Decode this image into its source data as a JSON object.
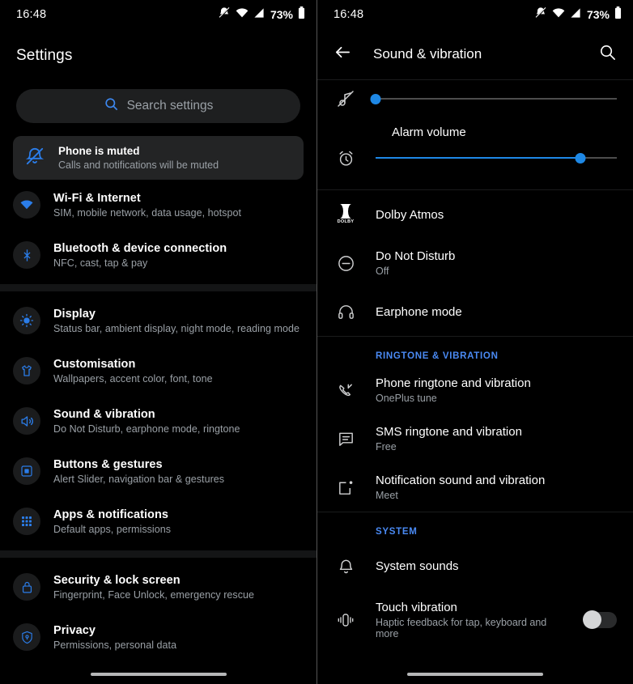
{
  "accent": "#1e88e5",
  "section_header_color": "#4a8af4",
  "status_bar": {
    "time": "16:48",
    "battery_percent": "73%",
    "icons": [
      "bell-slash-icon",
      "wifi-icon",
      "signal-icon",
      "battery-icon"
    ]
  },
  "left_panel": {
    "title": "Settings",
    "search": {
      "placeholder": "Search settings",
      "icon": "search-icon"
    },
    "muted_banner": {
      "icon": "bell-slash-icon",
      "title": "Phone is muted",
      "subtitle": "Calls and notifications will be muted"
    },
    "groups": [
      {
        "items": [
          {
            "icon": "wifi-icon",
            "title": "Wi-Fi & Internet",
            "subtitle": "SIM, mobile network, data usage, hotspot"
          },
          {
            "icon": "bluetooth-icon",
            "title": "Bluetooth & device connection",
            "subtitle": "NFC, cast, tap & pay"
          }
        ]
      },
      {
        "items": [
          {
            "icon": "brightness-icon",
            "title": "Display",
            "subtitle": "Status bar, ambient display, night mode, reading mode"
          },
          {
            "icon": "tshirt-icon",
            "title": "Customisation",
            "subtitle": "Wallpapers, accent color, font, tone"
          },
          {
            "icon": "speaker-icon",
            "title": "Sound & vibration",
            "subtitle": "Do Not Disturb, earphone mode, ringtone"
          },
          {
            "icon": "button-box-icon",
            "title": "Buttons & gestures",
            "subtitle": "Alert Slider, navigation bar & gestures"
          },
          {
            "icon": "app-grid-icon",
            "title": "Apps & notifications",
            "subtitle": "Default apps, permissions"
          }
        ]
      },
      {
        "items": [
          {
            "icon": "lock-icon",
            "title": "Security & lock screen",
            "subtitle": "Fingerprint, Face Unlock, emergency rescue"
          },
          {
            "icon": "shield-icon",
            "title": "Privacy",
            "subtitle": "Permissions, personal data"
          }
        ]
      }
    ]
  },
  "right_panel": {
    "header": {
      "back_icon": "arrow-left-icon",
      "title": "Sound & vibration",
      "search_icon": "search-icon"
    },
    "sliders": [
      {
        "icon": "ring-volume-muted-icon",
        "label": "",
        "value": 0,
        "max": 100
      },
      {
        "icon": "alarm-clock-icon",
        "label": "Alarm volume",
        "value": 85,
        "max": 100
      }
    ],
    "groups": [
      {
        "header": "",
        "items": [
          {
            "icon": "dolby-icon",
            "title": "Dolby Atmos",
            "subtitle": ""
          },
          {
            "icon": "do-not-disturb-icon",
            "title": "Do Not Disturb",
            "subtitle": "Off"
          },
          {
            "icon": "headphones-icon",
            "title": "Earphone mode",
            "subtitle": ""
          }
        ]
      },
      {
        "header": "RINGTONE & VIBRATION",
        "items": [
          {
            "icon": "phone-ring-icon",
            "title": "Phone ringtone and vibration",
            "subtitle": "OnePlus tune"
          },
          {
            "icon": "message-icon",
            "title": "SMS ringtone and vibration",
            "subtitle": "Free"
          },
          {
            "icon": "notification-square-icon",
            "title": "Notification sound and vibration",
            "subtitle": "Meet"
          }
        ]
      },
      {
        "header": "SYSTEM",
        "items": [
          {
            "icon": "bell-icon",
            "title": "System sounds",
            "subtitle": ""
          },
          {
            "icon": "vibration-icon",
            "title": "Touch vibration",
            "subtitle": "Haptic feedback for tap, keyboard and more",
            "toggle": "off"
          }
        ]
      }
    ]
  }
}
